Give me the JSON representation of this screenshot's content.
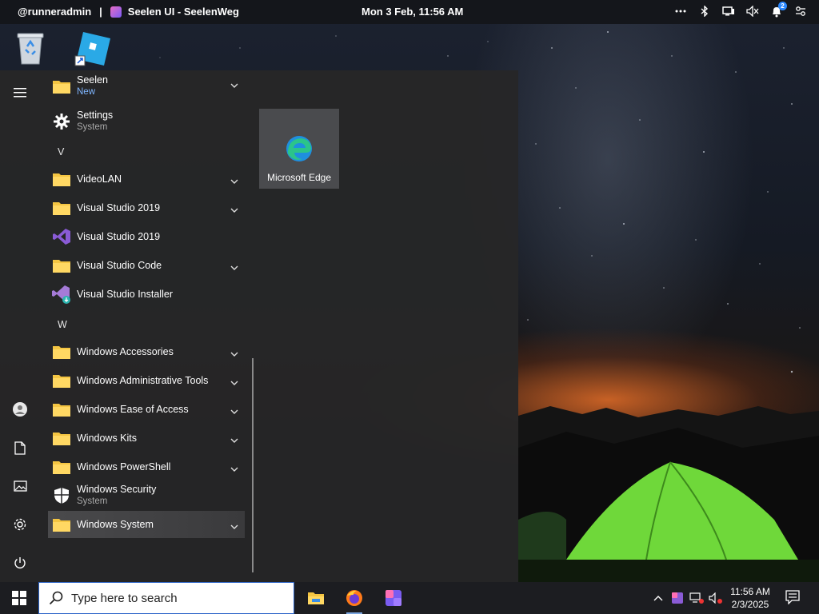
{
  "topbar": {
    "user": "@runneradmin",
    "separator": "|",
    "app_title": "Seelen UI - SeelenWeg",
    "clock": "Mon 3 Feb, 11:56 AM",
    "notification_count": "2",
    "tray_icons": [
      "more-icon",
      "bluetooth-icon",
      "display-icon",
      "volume-muted-icon",
      "notifications-icon",
      "settings-sliders-icon"
    ]
  },
  "desktop": {
    "icons": [
      "recycle-bin-icon",
      "roblox-shortcut-icon"
    ]
  },
  "start_menu": {
    "rail": [
      "menu-icon",
      "user-icon",
      "documents-icon",
      "pictures-icon",
      "settings-icon",
      "power-icon"
    ],
    "apps": [
      {
        "label": "Seelen",
        "sub": "New"
      },
      {
        "label": "Settings",
        "sub": "System"
      },
      {
        "letter": "V"
      },
      {
        "label": "VideoLAN"
      },
      {
        "label": "Visual Studio 2019"
      },
      {
        "label": "Visual Studio 2019"
      },
      {
        "label": "Visual Studio Code"
      },
      {
        "label": "Visual Studio Installer"
      },
      {
        "letter": "W"
      },
      {
        "label": "Windows Accessories"
      },
      {
        "label": "Windows Administrative Tools"
      },
      {
        "label": "Windows Ease of Access"
      },
      {
        "label": "Windows Kits"
      },
      {
        "label": "Windows PowerShell"
      },
      {
        "label": "Windows Security",
        "sub": "System"
      },
      {
        "label": "Windows System"
      }
    ],
    "tile": {
      "label": "Microsoft Edge"
    }
  },
  "taskbar": {
    "search_placeholder": "Type here to search",
    "pinned": [
      "file-explorer-icon",
      "firefox-icon",
      "seelen-ui-icon"
    ],
    "time": "11:56 AM",
    "date": "2/3/2025"
  }
}
